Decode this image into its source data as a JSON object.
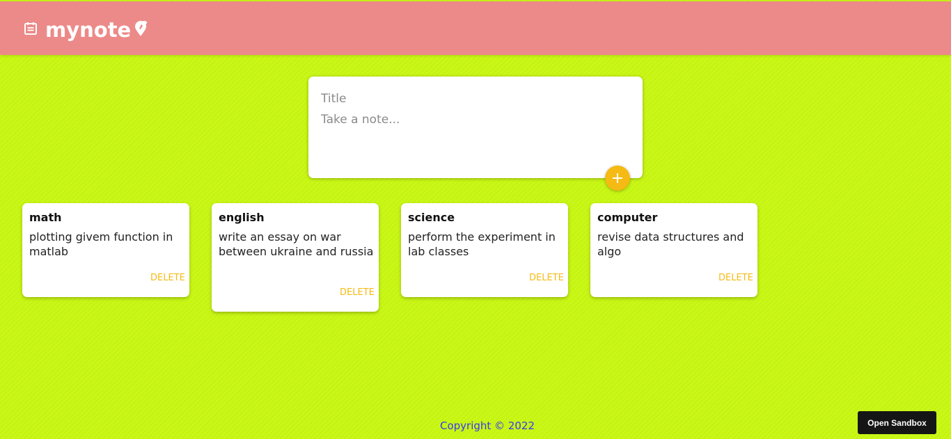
{
  "header": {
    "title": "mynote",
    "background": "#ec8a89",
    "icons": [
      "note-icon",
      "pin-icon"
    ]
  },
  "composer": {
    "title_placeholder": "Title",
    "content_placeholder": "Take a note...",
    "add_icon": "plus-icon"
  },
  "notes": [
    {
      "title": "math",
      "content": "plotting givem function in matlab",
      "delete_label": "DELETE"
    },
    {
      "title": "english",
      "content": "write an essay on war between ukraine and russia",
      "delete_label": "DELETE"
    },
    {
      "title": "science",
      "content": "perform the experiment in lab classes",
      "delete_label": "DELETE"
    },
    {
      "title": "computer",
      "content": "revise data structures and algo",
      "delete_label": "DELETE"
    }
  ],
  "footer": {
    "text": "Copyright © 2022"
  },
  "sandbox": {
    "label": "Open Sandbox"
  },
  "colors": {
    "background": "#c9f716",
    "accent": "#f5ba13",
    "footer_text": "#3a3af0"
  }
}
